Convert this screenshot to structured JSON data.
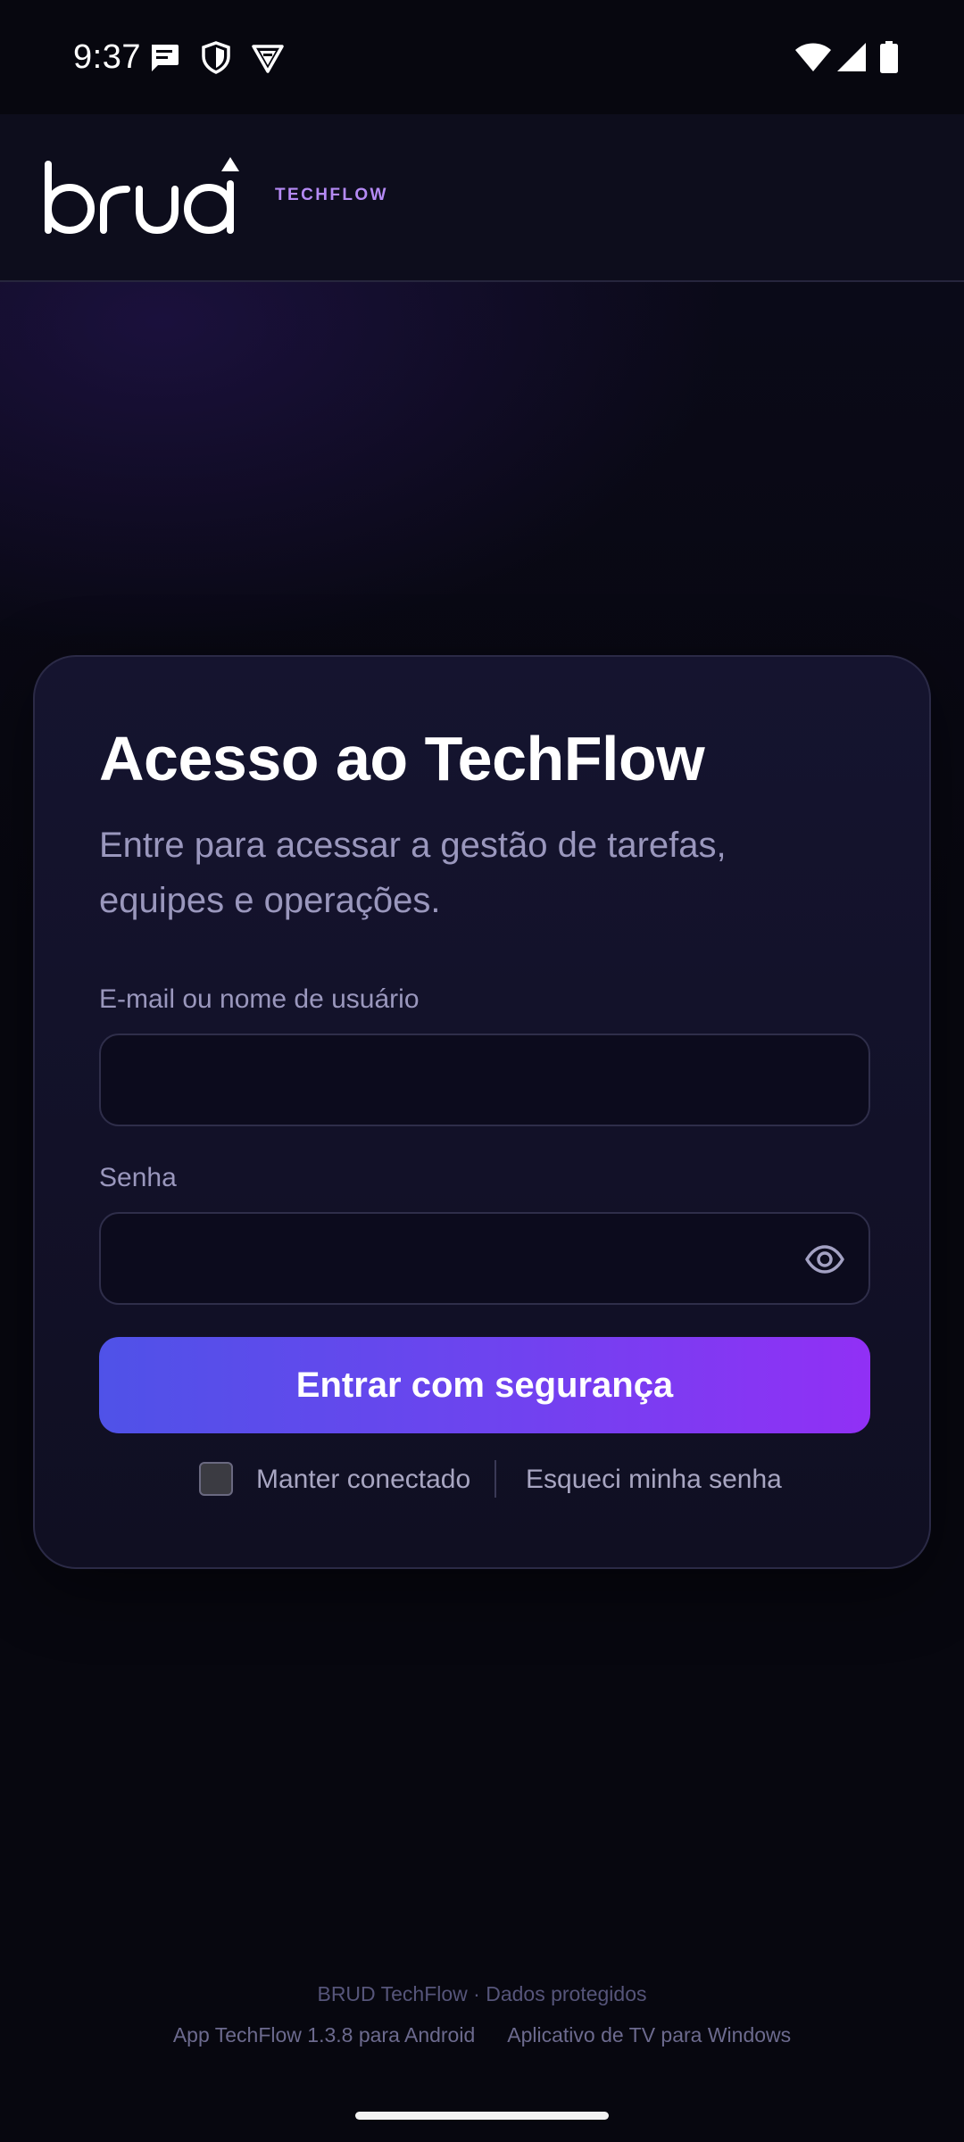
{
  "status_bar": {
    "time": "9:37",
    "left_icons": [
      "message-icon",
      "shield-icon",
      "vpn-icon"
    ],
    "right_icons": [
      "wifi-icon",
      "signal-icon",
      "battery-icon"
    ]
  },
  "header": {
    "logo_text": "brud",
    "brand_tag": "TECHFLOW"
  },
  "login": {
    "title": "Acesso ao TechFlow",
    "subtitle": "Entre para acessar a gestão de tarefas, equipes e operações.",
    "username": {
      "label": "E-mail ou nome de usuário",
      "value": "",
      "placeholder": ""
    },
    "password": {
      "label": "Senha",
      "value": "",
      "placeholder": "",
      "toggle_icon": "eye-icon"
    },
    "submit_label": "Entrar com segurança",
    "remember_label": "Manter conectado",
    "remember_checked": false,
    "forgot_label": "Esqueci minha senha"
  },
  "footer": {
    "note": "BRUD TechFlow · Dados protegidos",
    "links": [
      "App TechFlow 1.3.8 para Android",
      "Aplicativo de TV para Windows"
    ]
  },
  "colors": {
    "background": "#07070f",
    "card": "#14132d",
    "accent_start": "#4f52e8",
    "accent_end": "#9130f5",
    "brand_tag": "#b58af5",
    "muted_text": "#9a97bd"
  }
}
